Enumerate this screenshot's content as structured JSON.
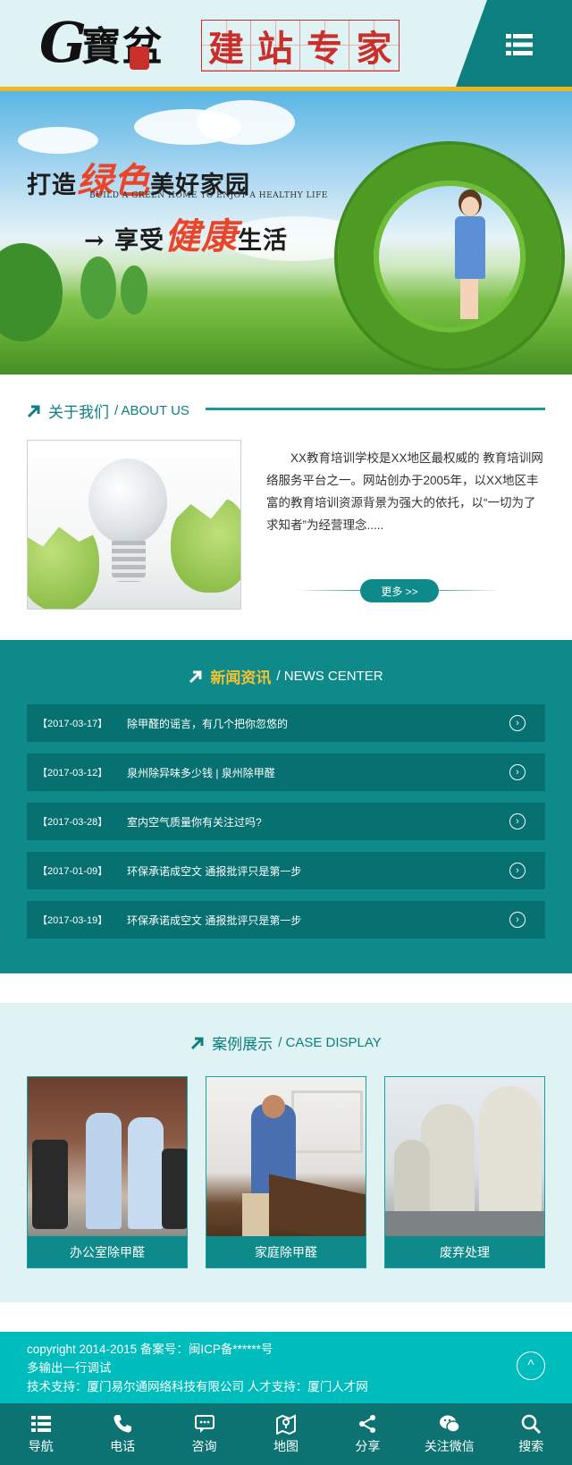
{
  "header": {
    "logo_letter": "G",
    "logo_name": "寶盆",
    "logo_tag": [
      "建",
      "站",
      "专",
      "家"
    ]
  },
  "banner": {
    "slogan_line1_prefix": "打造",
    "slogan_line1_highlight": "绿色",
    "slogan_line1_suffix": "美好家园",
    "slogan_subtitle": "BUILD A GREEN HOME TO ENJOY A HEALTHY LIFE",
    "slogan_line2_arrow": "→",
    "slogan_line2_prefix": "享受",
    "slogan_line2_highlight": "健康",
    "slogan_line2_suffix": "生活"
  },
  "about": {
    "title_cn": "关于我们",
    "title_en": "/ ABOUT US",
    "text": "XX教育培训学校是XX地区最权威的 教育培训网络服务平台之一。网站创办于2005年，以XX地区丰富的教育培训资源背景为强大的依托，以“一切为了求知者”为经营理念.....",
    "more_label": "更多 >>"
  },
  "news": {
    "title_cn": "新闻资讯",
    "title_en": "/ NEWS CENTER",
    "items": [
      {
        "date": "【2017-03-17】",
        "title": "除甲醛的谣言，有几个把你忽悠的"
      },
      {
        "date": "【2017-03-12】",
        "title": "泉州除异味多少钱 | 泉州除甲醛"
      },
      {
        "date": "【2017-03-28】",
        "title": "室内空气质量你有关注过吗?"
      },
      {
        "date": "【2017-01-09】",
        "title": "环保承诺成空文 通报批评只是第一步"
      },
      {
        "date": "【2017-03-19】",
        "title": "环保承诺成空文 通报批评只是第一步"
      }
    ]
  },
  "cases": {
    "title_cn": "案例展示",
    "title_en": "/ CASE DISPLAY",
    "items": [
      {
        "label": "办公室除甲醛"
      },
      {
        "label": "家庭除甲醛"
      },
      {
        "label": "废弃处理"
      }
    ]
  },
  "footer": {
    "line1": "copyright 2014-2015 备案号：闽ICP备******号",
    "line2": "多输出一行调试",
    "line3": "技术支持：厦门易尔通网络科技有限公司 人才支持：厦门人才网",
    "top_symbol": "^"
  },
  "bottom_nav": [
    {
      "label": "导航",
      "icon": "menu-icon"
    },
    {
      "label": "电话",
      "icon": "phone-icon"
    },
    {
      "label": "咨询",
      "icon": "chat-icon"
    },
    {
      "label": "地图",
      "icon": "map-icon"
    },
    {
      "label": "分享",
      "icon": "share-icon"
    },
    {
      "label": "关注微信",
      "icon": "wechat-icon"
    },
    {
      "label": "搜索",
      "icon": "search-icon"
    }
  ],
  "colors": {
    "primary": "#0e8a8a",
    "dark": "#077070",
    "accent": "#f2c230",
    "light_bg": "#dff3f4",
    "footer": "#00bdbd"
  }
}
